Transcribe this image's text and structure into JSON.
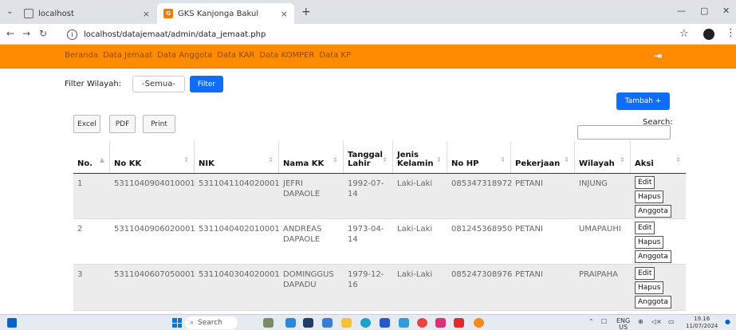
{
  "browser": {
    "tabs": [
      {
        "title": "localhost",
        "active": false
      },
      {
        "title": "GKS Kanjonga Bakul",
        "active": true
      }
    ],
    "url": "localhost/datajemaat/admin/data_jemaat.php"
  },
  "nav": {
    "links": [
      "Beranda",
      "Data Jemaat",
      "Data Anggota",
      "Data KAR",
      "Data KOMPER",
      "Data KP"
    ],
    "logout_icon": "logout-icon"
  },
  "filter": {
    "label": "Filter Wilayah:",
    "selected": "-Semua-",
    "button": "Filter"
  },
  "toolbar": {
    "tambah": "Tambah +",
    "excel": "Excel",
    "pdf": "PDF",
    "print": "Print",
    "search_label": "Search:"
  },
  "table": {
    "columns": [
      "No.",
      "No KK",
      "NIK",
      "Nama KK",
      "Tanggal Lahir",
      "Jenis Kelamin",
      "No HP",
      "Pekerjaan",
      "Wilayah",
      "Aksi"
    ],
    "rows": [
      {
        "no": "1",
        "no_kk": "5311040904010001",
        "nik": "5311041104020001",
        "nama": "JEFRI DAPAOLE",
        "tgl": "1992-07-14",
        "jk": "Laki-Laki",
        "hp": "085347318972",
        "pekerjaan": "PETANI",
        "wilayah": "INJUNG"
      },
      {
        "no": "2",
        "no_kk": "5311040906020001",
        "nik": "5311040402010001",
        "nama": "ANDREAS DAPAOLE",
        "tgl": "1973-04-14",
        "jk": "Laki-Laki",
        "hp": "081245368950",
        "pekerjaan": "PETANI",
        "wilayah": "UMAPAUHI"
      },
      {
        "no": "3",
        "no_kk": "5311040607050001",
        "nik": "5311040304020001",
        "nama": "DOMINGGUS DAPADU",
        "tgl": "1979-12-16",
        "jk": "Laki-Laki",
        "hp": "085247308976",
        "pekerjaan": "PETANI",
        "wilayah": "PRAIPAHA"
      }
    ],
    "actions": [
      "Edit",
      "Hapus",
      "Anggota"
    ]
  },
  "taskbar": {
    "search": "Search",
    "lang": "ENG",
    "region": "US",
    "time": "19.16",
    "date": "11/07/2024"
  }
}
